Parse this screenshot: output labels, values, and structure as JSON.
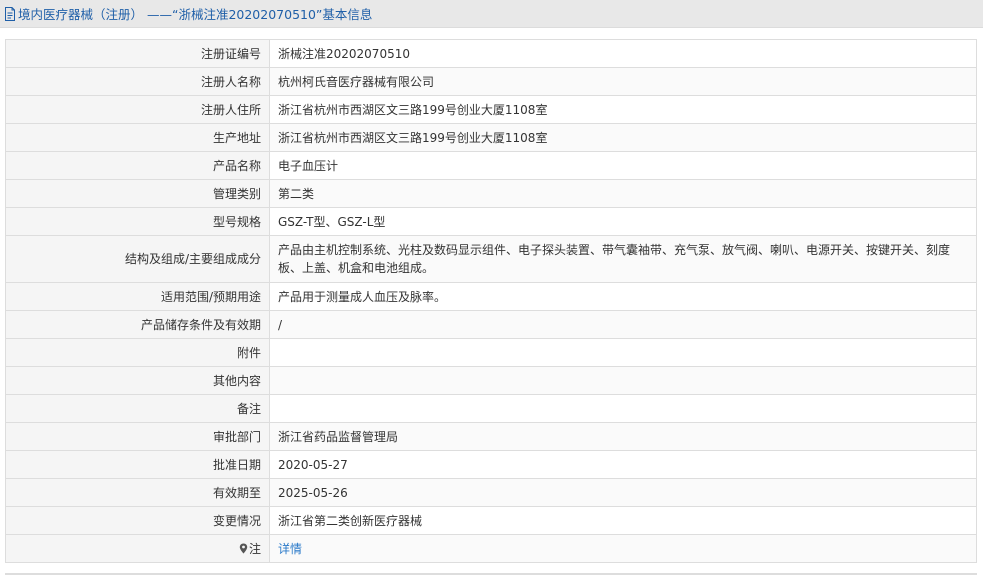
{
  "header": {
    "title": "境内医疗器械（注册） ——“浙械注准20202070510”基本信息"
  },
  "rows": [
    {
      "label": "注册证编号",
      "value": "浙械注准20202070510"
    },
    {
      "label": "注册人名称",
      "value": "杭州柯氏音医疗器械有限公司"
    },
    {
      "label": "注册人住所",
      "value": "浙江省杭州市西湖区文三路199号创业大厦1108室"
    },
    {
      "label": "生产地址",
      "value": "浙江省杭州市西湖区文三路199号创业大厦1108室"
    },
    {
      "label": "产品名称",
      "value": "电子血压计"
    },
    {
      "label": "管理类别",
      "value": "第二类"
    },
    {
      "label": "型号规格",
      "value": "GSZ-T型、GSZ-L型"
    },
    {
      "label": "结构及组成/主要组成成分",
      "value": "产品由主机控制系统、光柱及数码显示组件、电子探头装置、带气囊袖带、充气泵、放气阀、喇叭、电源开关、按键开关、刻度板、上盖、机盒和电池组成。"
    },
    {
      "label": "适用范围/预期用途",
      "value": "产品用于测量成人血压及脉率。"
    },
    {
      "label": "产品储存条件及有效期",
      "value": "/"
    },
    {
      "label": "附件",
      "value": ""
    },
    {
      "label": "其他内容",
      "value": ""
    },
    {
      "label": "备注",
      "value": ""
    },
    {
      "label": "审批部门",
      "value": "浙江省药品监督管理局"
    },
    {
      "label": "批准日期",
      "value": "2020-05-27"
    },
    {
      "label": "有效期至",
      "value": "2025-05-26"
    },
    {
      "label": "变更情况",
      "value": "浙江省第二类创新医疗器械"
    },
    {
      "label": "注",
      "value": "详情",
      "icon": "map-pin-icon",
      "link_color": "#2a7ac9"
    }
  ],
  "colors": {
    "title": "#1f5fa8",
    "label_bg": "#f5f5f5",
    "border": "#dddddd",
    "header_bg": "#e8e8e8",
    "link": "#2a7ac9"
  }
}
